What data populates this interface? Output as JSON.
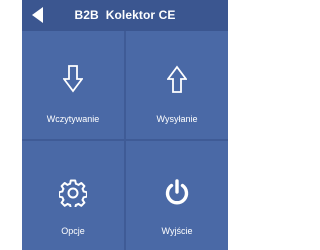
{
  "header": {
    "title": "B2B  Kolektor CE"
  },
  "tiles": [
    {
      "label": "Wczytywanie",
      "icon": "arrow-down-icon"
    },
    {
      "label": "Wysyłanie",
      "icon": "arrow-up-icon"
    },
    {
      "label": "Opcje",
      "icon": "gear-icon"
    },
    {
      "label": "Wyjście",
      "icon": "power-icon"
    }
  ],
  "colors": {
    "background": "#3f5b96",
    "tile": "#4a69a6",
    "text": "#ffffff"
  }
}
